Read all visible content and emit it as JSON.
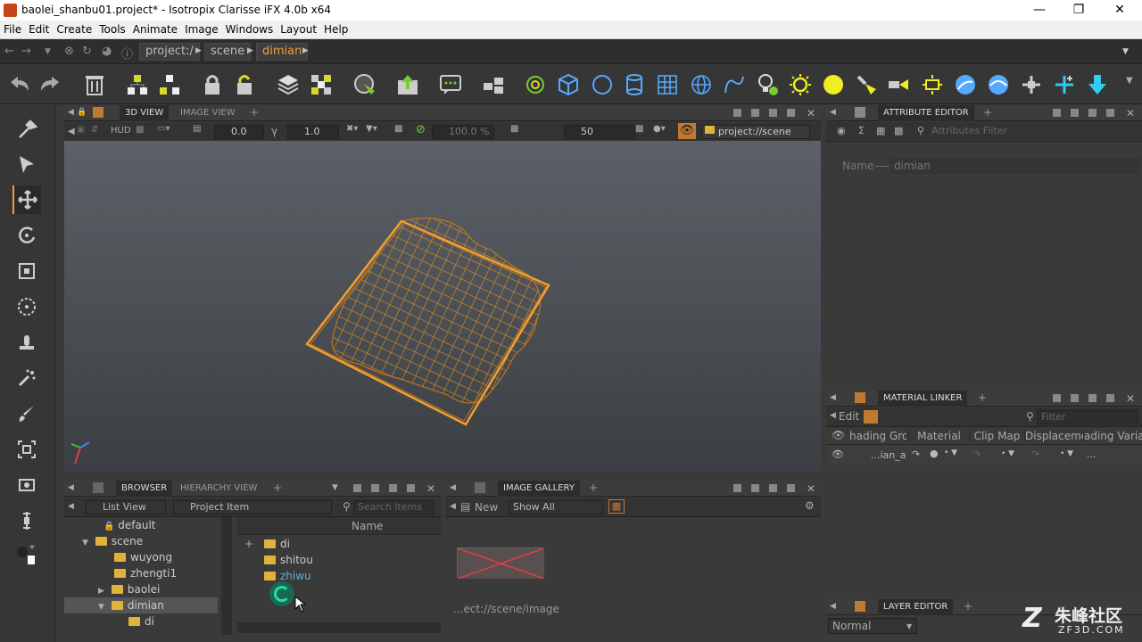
{
  "window": {
    "title": "baolei_shanbu01.project* - Isotropix Clarisse iFX 4.0b x64",
    "min": "—",
    "max": "❐",
    "close": "✕"
  },
  "menu": [
    "File",
    "Edit",
    "Create",
    "Tools",
    "Animate",
    "Image",
    "Windows",
    "Layout",
    "Help"
  ],
  "breadcrumb": [
    "project:/",
    "scene",
    "dimian"
  ],
  "viewport": {
    "tabs": [
      "3D VIEW",
      "IMAGE VIEW"
    ],
    "hud": "HUD",
    "v1": "0.0",
    "gamma": "1.0",
    "zoom": "100.0 %",
    "samples": "50",
    "context": "project://scene"
  },
  "attribute_editor": {
    "title": "ATTRIBUTE EDITOR",
    "filter_placeholder": "Attributes Filter",
    "name_label": "Name",
    "name_value": "dimian"
  },
  "material_linker": {
    "title": "MATERIAL LINKER",
    "edit": "Edit",
    "filter_placeholder": "Filter",
    "columns": [
      "hading Grou",
      "Material",
      "Clip Map",
      "Displacemen",
      "ading Variab"
    ],
    "row": {
      "name": "...ian_a",
      "more": "..."
    }
  },
  "layer_editor": {
    "title": "LAYER EDITOR",
    "mode": "Normal"
  },
  "browser": {
    "tabs": [
      "BROWSER",
      "HIERARCHY VIEW"
    ],
    "view_mode": "List View",
    "item_type": "Project Item",
    "search_placeholder": "Search Items",
    "tree": [
      {
        "label": "default",
        "indent": 1,
        "folder": false
      },
      {
        "label": "scene",
        "indent": 1,
        "folder": true
      },
      {
        "label": "wuyong",
        "indent": 2,
        "folder": true
      },
      {
        "label": "zhengti1",
        "indent": 2,
        "folder": true
      },
      {
        "label": "baolei",
        "indent": 2,
        "folder": true
      },
      {
        "label": "dimian",
        "indent": 2,
        "folder": true
      },
      {
        "label": "di",
        "indent": 3,
        "folder": true
      }
    ],
    "column_name": "Name",
    "items": [
      "di",
      "shitou",
      "zhiwu"
    ]
  },
  "gallery": {
    "title": "IMAGE GALLERY",
    "new": "New",
    "show": "Show All",
    "caption": "...ect://scene/image"
  },
  "watermark": {
    "cn": "朱峰社区",
    "url": "ZF3D.COM"
  }
}
